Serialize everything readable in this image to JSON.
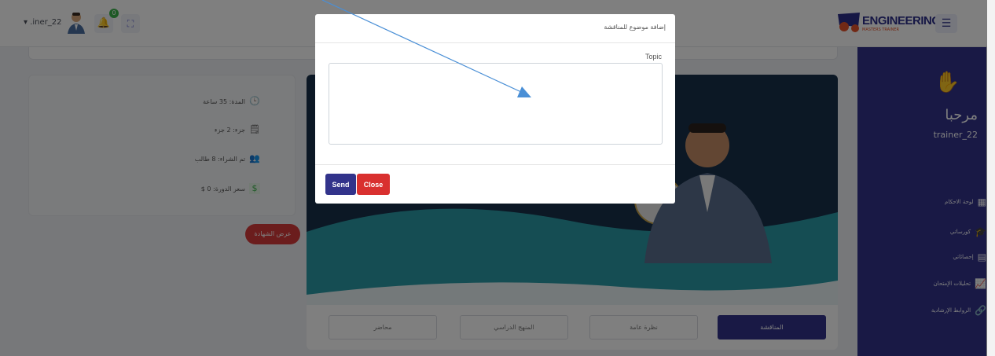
{
  "header": {
    "user_label": "▾ .iner_22",
    "notification_count": "0",
    "logo_text": "ENGINEERING",
    "logo_sub": "MASTERS TRAINER"
  },
  "sidebar": {
    "welcome": "مرحبا",
    "username": "trainer_22",
    "items": [
      {
        "label": "لوحة الاحكام",
        "icon": "dashboard-icon"
      },
      {
        "label": "كورساتي",
        "icon": "courses-icon"
      },
      {
        "label": "إحصائاتي",
        "icon": "stats-icon"
      },
      {
        "label": "تحليلات الإمتحان",
        "icon": "chart-icon"
      },
      {
        "label": "الروابط الإرشادية",
        "icon": "links-icon"
      }
    ]
  },
  "course_info": {
    "duration": "المدة: 35 ساعة",
    "parts": "جزء: 2 جزء",
    "students": "تم الشراء: 8 طالب",
    "price": "سعر الدورة: 0 $"
  },
  "certificate_button": "عرض الشهادة",
  "tabs": [
    {
      "label": "المناقشة",
      "active": true
    },
    {
      "label": "نظرة عامة",
      "active": false
    },
    {
      "label": "المنهج الدراسي",
      "active": false
    },
    {
      "label": "محاضر",
      "active": false
    }
  ],
  "modal": {
    "title": "إضافة موضوع للمناقشة",
    "topic_label": "Topic",
    "topic_value": "",
    "send_label": "Send",
    "close_label": "Close"
  },
  "colors": {
    "primary": "#32338b",
    "danger": "#d9302f",
    "teal": "#2a9ba6",
    "navy_banner": "#18304a"
  }
}
